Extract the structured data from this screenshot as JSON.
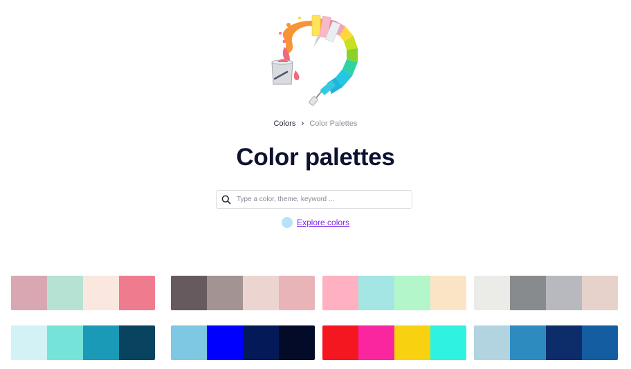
{
  "breadcrumb": {
    "root": "Colors",
    "current": "Color Palettes"
  },
  "title": "Color palettes",
  "search": {
    "placeholder": "Type a color, theme, keyword ...",
    "value": ""
  },
  "explore": {
    "label": "Explore colors",
    "swatch_color": "#b8e2f8"
  },
  "hero": {
    "icon": "paint-wheel-illustration"
  },
  "palettes": [
    [
      "#d8a7b1",
      "#b6e2d3",
      "#fae8e0",
      "#ef7c8e"
    ],
    [
      "#665a5e",
      "#a39392",
      "#ecd5d0",
      "#e8b4b8"
    ],
    [
      "#ffb1c1",
      "#a3e6e4",
      "#b2f6c9",
      "#fbe4c6"
    ],
    [
      "#ebebe8",
      "#878b8e",
      "#b8b8bf",
      "#e6d1cb"
    ],
    [
      "#d3f2f5",
      "#76e3d9",
      "#1a9ab6",
      "#08435f"
    ],
    [
      "#7ec8e3",
      "#0000ff",
      "#041a58",
      "#040b28"
    ],
    [
      "#f51720",
      "#fa26a0",
      "#f8d210",
      "#2ff3e0"
    ],
    [
      "#b1d4e0",
      "#2e8bc0",
      "#0c2d6a",
      "#145da0"
    ]
  ]
}
